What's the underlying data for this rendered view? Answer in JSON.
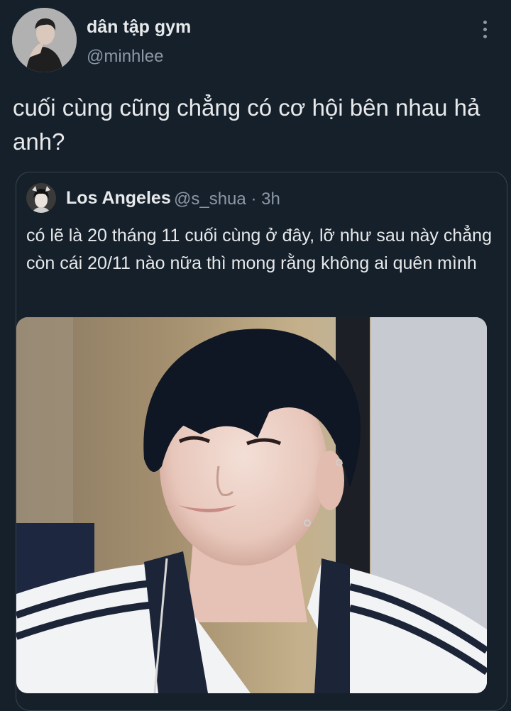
{
  "tweet": {
    "display_name": "dân tập gym",
    "handle": "@minhlee",
    "text": "cuối cùng cũng chẳng có cơ hội bên nhau hả anh?",
    "avatar_icon": "user-avatar-photo"
  },
  "more_icon": "more-vertical-icon",
  "quoted_tweet": {
    "display_name": "Los Angeles",
    "handle": "@s_shua",
    "separator": "·",
    "time": "3h",
    "text": "có lẽ là 20 tháng 11 cuối cùng ở đây, lỡ như sau này chẳng còn cái 20/11 nào nữa thì mong rằng không ai quên mình",
    "media_icon": "photo-media"
  },
  "colors": {
    "background": "#15202b",
    "primary_text": "#e7e9ea",
    "secondary_text": "#8b98a5",
    "border": "#38444d"
  }
}
